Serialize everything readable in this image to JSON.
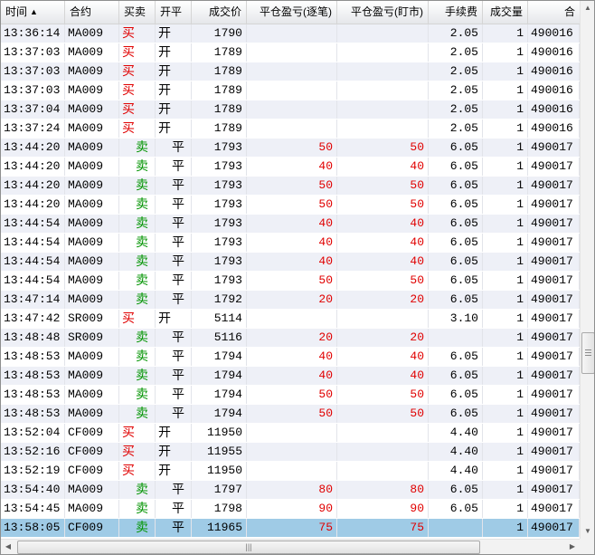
{
  "columns": {
    "time": "时间",
    "sort_indicator": "▲",
    "contract": "合约",
    "side": "买卖",
    "open_close": "开平",
    "price": "成交价",
    "pnl_trade": "平仓盈亏(逐笔)",
    "pnl_mtm": "平仓盈亏(盯市)",
    "fee": "手续费",
    "qty": "成交量",
    "order": "合"
  },
  "rows": [
    {
      "time": "13:36:14",
      "contract": "MA009",
      "side": "买",
      "oc": "开",
      "price": "1790",
      "pnl1": "",
      "pnl2": "",
      "fee": "2.05",
      "qty": "1",
      "order": "490016"
    },
    {
      "time": "13:37:03",
      "contract": "MA009",
      "side": "买",
      "oc": "开",
      "price": "1789",
      "pnl1": "",
      "pnl2": "",
      "fee": "2.05",
      "qty": "1",
      "order": "490016"
    },
    {
      "time": "13:37:03",
      "contract": "MA009",
      "side": "买",
      "oc": "开",
      "price": "1789",
      "pnl1": "",
      "pnl2": "",
      "fee": "2.05",
      "qty": "1",
      "order": "490016"
    },
    {
      "time": "13:37:03",
      "contract": "MA009",
      "side": "买",
      "oc": "开",
      "price": "1789",
      "pnl1": "",
      "pnl2": "",
      "fee": "2.05",
      "qty": "1",
      "order": "490016"
    },
    {
      "time": "13:37:04",
      "contract": "MA009",
      "side": "买",
      "oc": "开",
      "price": "1789",
      "pnl1": "",
      "pnl2": "",
      "fee": "2.05",
      "qty": "1",
      "order": "490016"
    },
    {
      "time": "13:37:24",
      "contract": "MA009",
      "side": "买",
      "oc": "开",
      "price": "1789",
      "pnl1": "",
      "pnl2": "",
      "fee": "2.05",
      "qty": "1",
      "order": "490016"
    },
    {
      "time": "13:44:20",
      "contract": "MA009",
      "side": "卖",
      "oc": "平",
      "price": "1793",
      "pnl1": "50",
      "pnl2": "50",
      "fee": "6.05",
      "qty": "1",
      "order": "490017"
    },
    {
      "time": "13:44:20",
      "contract": "MA009",
      "side": "卖",
      "oc": "平",
      "price": "1793",
      "pnl1": "40",
      "pnl2": "40",
      "fee": "6.05",
      "qty": "1",
      "order": "490017"
    },
    {
      "time": "13:44:20",
      "contract": "MA009",
      "side": "卖",
      "oc": "平",
      "price": "1793",
      "pnl1": "50",
      "pnl2": "50",
      "fee": "6.05",
      "qty": "1",
      "order": "490017"
    },
    {
      "time": "13:44:20",
      "contract": "MA009",
      "side": "卖",
      "oc": "平",
      "price": "1793",
      "pnl1": "50",
      "pnl2": "50",
      "fee": "6.05",
      "qty": "1",
      "order": "490017"
    },
    {
      "time": "13:44:54",
      "contract": "MA009",
      "side": "卖",
      "oc": "平",
      "price": "1793",
      "pnl1": "40",
      "pnl2": "40",
      "fee": "6.05",
      "qty": "1",
      "order": "490017"
    },
    {
      "time": "13:44:54",
      "contract": "MA009",
      "side": "卖",
      "oc": "平",
      "price": "1793",
      "pnl1": "40",
      "pnl2": "40",
      "fee": "6.05",
      "qty": "1",
      "order": "490017"
    },
    {
      "time": "13:44:54",
      "contract": "MA009",
      "side": "卖",
      "oc": "平",
      "price": "1793",
      "pnl1": "40",
      "pnl2": "40",
      "fee": "6.05",
      "qty": "1",
      "order": "490017"
    },
    {
      "time": "13:44:54",
      "contract": "MA009",
      "side": "卖",
      "oc": "平",
      "price": "1793",
      "pnl1": "50",
      "pnl2": "50",
      "fee": "6.05",
      "qty": "1",
      "order": "490017"
    },
    {
      "time": "13:47:14",
      "contract": "MA009",
      "side": "卖",
      "oc": "平",
      "price": "1792",
      "pnl1": "20",
      "pnl2": "20",
      "fee": "6.05",
      "qty": "1",
      "order": "490017"
    },
    {
      "time": "13:47:42",
      "contract": "SR009",
      "side": "买",
      "oc": "开",
      "price": "5114",
      "pnl1": "",
      "pnl2": "",
      "fee": "3.10",
      "qty": "1",
      "order": "490017"
    },
    {
      "time": "13:48:48",
      "contract": "SR009",
      "side": "卖",
      "oc": "平",
      "price": "5116",
      "pnl1": "20",
      "pnl2": "20",
      "fee": "",
      "qty": "1",
      "order": "490017"
    },
    {
      "time": "13:48:53",
      "contract": "MA009",
      "side": "卖",
      "oc": "平",
      "price": "1794",
      "pnl1": "40",
      "pnl2": "40",
      "fee": "6.05",
      "qty": "1",
      "order": "490017"
    },
    {
      "time": "13:48:53",
      "contract": "MA009",
      "side": "卖",
      "oc": "平",
      "price": "1794",
      "pnl1": "40",
      "pnl2": "40",
      "fee": "6.05",
      "qty": "1",
      "order": "490017"
    },
    {
      "time": "13:48:53",
      "contract": "MA009",
      "side": "卖",
      "oc": "平",
      "price": "1794",
      "pnl1": "50",
      "pnl2": "50",
      "fee": "6.05",
      "qty": "1",
      "order": "490017"
    },
    {
      "time": "13:48:53",
      "contract": "MA009",
      "side": "卖",
      "oc": "平",
      "price": "1794",
      "pnl1": "50",
      "pnl2": "50",
      "fee": "6.05",
      "qty": "1",
      "order": "490017"
    },
    {
      "time": "13:52:04",
      "contract": "CF009",
      "side": "买",
      "oc": "开",
      "price": "11950",
      "pnl1": "",
      "pnl2": "",
      "fee": "4.40",
      "qty": "1",
      "order": "490017"
    },
    {
      "time": "13:52:16",
      "contract": "CF009",
      "side": "买",
      "oc": "开",
      "price": "11955",
      "pnl1": "",
      "pnl2": "",
      "fee": "4.40",
      "qty": "1",
      "order": "490017"
    },
    {
      "time": "13:52:19",
      "contract": "CF009",
      "side": "买",
      "oc": "开",
      "price": "11950",
      "pnl1": "",
      "pnl2": "",
      "fee": "4.40",
      "qty": "1",
      "order": "490017"
    },
    {
      "time": "13:54:40",
      "contract": "MA009",
      "side": "卖",
      "oc": "平",
      "price": "1797",
      "pnl1": "80",
      "pnl2": "80",
      "fee": "6.05",
      "qty": "1",
      "order": "490017"
    },
    {
      "time": "13:54:45",
      "contract": "MA009",
      "side": "卖",
      "oc": "平",
      "price": "1798",
      "pnl1": "90",
      "pnl2": "90",
      "fee": "6.05",
      "qty": "1",
      "order": "490017"
    },
    {
      "time": "13:58:05",
      "contract": "CF009",
      "side": "卖",
      "oc": "平",
      "price": "11965",
      "pnl1": "75",
      "pnl2": "75",
      "fee": "",
      "qty": "1",
      "order": "490017",
      "selected": true
    }
  ],
  "scrollbars": {
    "h_grip": "|||"
  },
  "colors": {
    "buy": "#e00000",
    "sell": "#009300",
    "pnl": "#e00000",
    "selected_row": "#9fcbe6",
    "alt_row": "#eef0f7"
  }
}
